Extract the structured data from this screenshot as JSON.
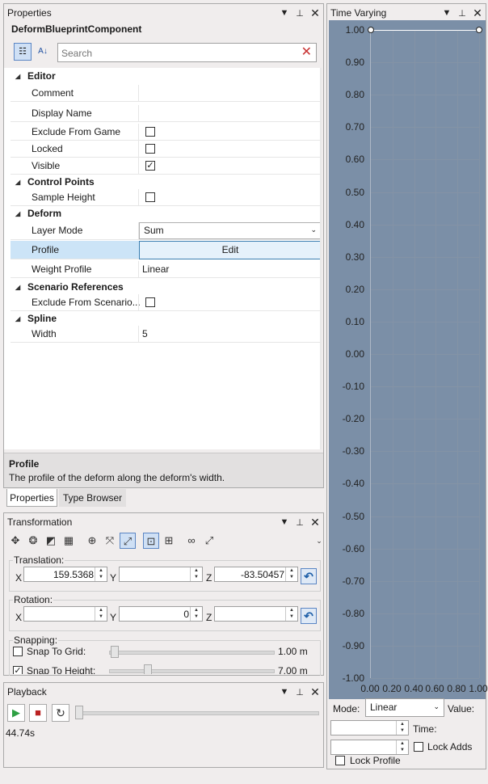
{
  "properties": {
    "title": "Properties",
    "component": "DeformBlueprintComponent",
    "search_placeholder": "Search",
    "categories": {
      "editor": "Editor",
      "control_points": "Control Points",
      "deform": "Deform",
      "scenario": "Scenario References",
      "spline": "Spline"
    },
    "rows": {
      "comment": "Comment",
      "display_name": "Display Name",
      "exclude_game": "Exclude From Game",
      "locked": "Locked",
      "visible": "Visible",
      "sample_height": "Sample Height",
      "layer_mode": "Layer Mode",
      "layer_mode_value": "Sum",
      "profile": "Profile",
      "profile_button": "Edit",
      "weight_profile": "Weight Profile",
      "weight_profile_value": "Linear",
      "exclude_scenario": "Exclude From Scenario...",
      "width": "Width",
      "width_value": "5"
    },
    "desc_title": "Profile",
    "desc_text": "The profile of the deform along the deform's width.",
    "tabs": [
      "Properties",
      "Type Browser"
    ]
  },
  "transformation": {
    "title": "Transformation",
    "translation_label": "Translation:",
    "rotation_label": "Rotation:",
    "snapping_label": "Snapping:",
    "axis_x": "X",
    "axis_y": "Y",
    "axis_z": "Z",
    "translation_x": "159.5368",
    "translation_y": "",
    "translation_z": "-83.50457",
    "rotation_x": "",
    "rotation_y": "0",
    "rotation_z": "",
    "snap_grid": "Snap To Grid:",
    "snap_grid_value": "1.00 m",
    "snap_height": "Snap To Height:",
    "snap_height_value": "7.00 m"
  },
  "playback": {
    "title": "Playback",
    "time": "44.74s"
  },
  "time_varying": {
    "title": "Time Varying",
    "mode_label": "Mode:",
    "mode_value": "Linear",
    "value_label": "Value:",
    "time_label": "Time:",
    "lock_adds": "Lock Adds",
    "lock_profile": "Lock Profile"
  },
  "chart_data": {
    "type": "line",
    "x": [
      0.0,
      1.0
    ],
    "y": [
      1.0,
      1.0
    ],
    "xlim": [
      0,
      1
    ],
    "ylim": [
      -1,
      1
    ],
    "xticks": [
      "0.00",
      "0.20",
      "0.40",
      "0.60",
      "0.80",
      "1.00"
    ],
    "yticks": [
      "1.00",
      "0.90",
      "0.80",
      "0.70",
      "0.60",
      "0.50",
      "0.40",
      "0.30",
      "0.20",
      "0.10",
      "0.00",
      "-0.10",
      "-0.20",
      "-0.30",
      "-0.40",
      "-0.50",
      "-0.60",
      "-0.70",
      "-0.80",
      "-0.90",
      "-1.00"
    ],
    "background": "#7b8fa7",
    "grid": true
  }
}
